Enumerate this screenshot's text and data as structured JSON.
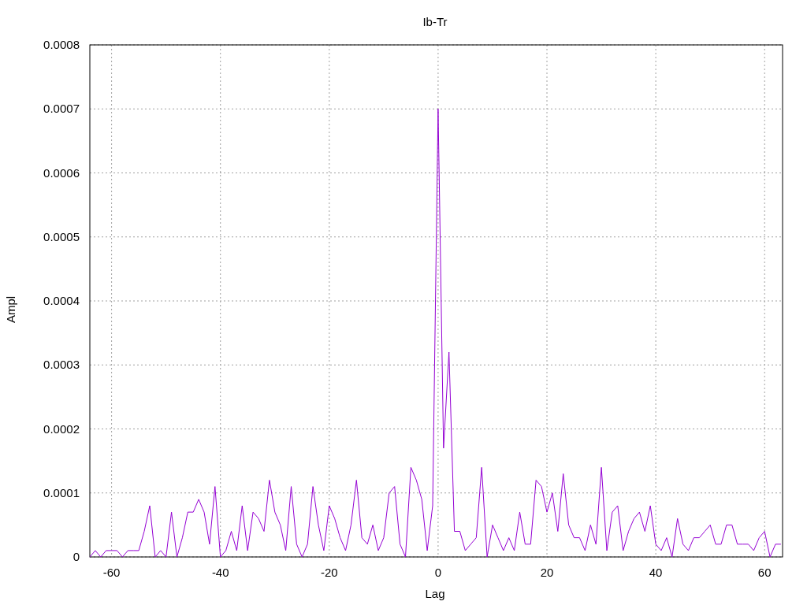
{
  "chart_data": {
    "type": "line",
    "title": "Ib-Tr",
    "xlabel": "Lag",
    "ylabel": "Ampl",
    "x": [
      -64,
      -63,
      -62,
      -61,
      -60,
      -59,
      -58,
      -57,
      -56,
      -55,
      -54,
      -53,
      -52,
      -51,
      -50,
      -49,
      -48,
      -47,
      -46,
      -45,
      -44,
      -43,
      -42,
      -41,
      -40,
      -39,
      -38,
      -37,
      -36,
      -35,
      -34,
      -33,
      -32,
      -31,
      -30,
      -29,
      -28,
      -27,
      -26,
      -25,
      -24,
      -23,
      -22,
      -21,
      -20,
      -19,
      -18,
      -17,
      -16,
      -15,
      -14,
      -13,
      -12,
      -11,
      -10,
      -9,
      -8,
      -7,
      -6,
      -5,
      -4,
      -3,
      -2,
      -1,
      0,
      1,
      2,
      3,
      4,
      5,
      6,
      7,
      8,
      9,
      10,
      11,
      12,
      13,
      14,
      15,
      16,
      17,
      18,
      19,
      20,
      21,
      22,
      23,
      24,
      25,
      26,
      27,
      28,
      29,
      30,
      31,
      32,
      33,
      34,
      35,
      36,
      37,
      38,
      39,
      40,
      41,
      42,
      43,
      44,
      45,
      46,
      47,
      48,
      49,
      50,
      51,
      52,
      53,
      54,
      55,
      56,
      57,
      58,
      59,
      60,
      61,
      62,
      63
    ],
    "series": [
      {
        "color": "#9400d3",
        "values": [
          0,
          1e-05,
          0,
          1e-05,
          1e-05,
          1e-05,
          0,
          1e-05,
          1e-05,
          1e-05,
          4e-05,
          8e-05,
          0,
          1e-05,
          0,
          7e-05,
          0,
          3e-05,
          7e-05,
          7e-05,
          9e-05,
          7e-05,
          2e-05,
          0.00011,
          0,
          1e-05,
          4e-05,
          1e-05,
          8e-05,
          1e-05,
          7e-05,
          6e-05,
          4e-05,
          0.00012,
          7e-05,
          5e-05,
          1e-05,
          0.00011,
          2e-05,
          0,
          2e-05,
          0.00011,
          5e-05,
          1e-05,
          8e-05,
          6e-05,
          3e-05,
          1e-05,
          5e-05,
          0.00012,
          3e-05,
          2e-05,
          5e-05,
          1e-05,
          3e-05,
          0.0001,
          0.00011,
          2e-05,
          0,
          0.00014,
          0.00012,
          9e-05,
          1e-05,
          8e-05,
          0.0007,
          0.00017,
          0.00032,
          4e-05,
          4e-05,
          1e-05,
          2e-05,
          3e-05,
          0.00014,
          0,
          5e-05,
          3e-05,
          1e-05,
          3e-05,
          1e-05,
          7e-05,
          2e-05,
          2e-05,
          0.00012,
          0.00011,
          7e-05,
          0.0001,
          4e-05,
          0.00013,
          5e-05,
          3e-05,
          3e-05,
          1e-05,
          5e-05,
          2e-05,
          0.00014,
          1e-05,
          7e-05,
          8e-05,
          1e-05,
          4e-05,
          6e-05,
          7e-05,
          4e-05,
          8e-05,
          2e-05,
          1e-05,
          3e-05,
          0,
          6e-05,
          2e-05,
          1e-05,
          3e-05,
          3e-05,
          4e-05,
          5e-05,
          2e-05,
          2e-05,
          5e-05,
          5e-05,
          2e-05,
          2e-05,
          2e-05,
          1e-05,
          3e-05,
          4e-05,
          0,
          2e-05,
          2e-05
        ]
      }
    ],
    "grid": true,
    "xlim": [
      -64,
      63.3
    ],
    "ylim": [
      0,
      0.0008
    ],
    "xticks": [
      -60,
      -40,
      -20,
      0,
      20,
      40,
      60
    ],
    "yticks": [
      {
        "value": 0,
        "label": "0"
      },
      {
        "value": 0.0001,
        "label": "0.0001"
      },
      {
        "value": 0.0002,
        "label": "0.0002"
      },
      {
        "value": 0.0003,
        "label": "0.0003"
      },
      {
        "value": 0.0004,
        "label": "0.0004"
      },
      {
        "value": 0.0005,
        "label": "0.0005"
      },
      {
        "value": 0.0006,
        "label": "0.0006"
      },
      {
        "value": 0.0007,
        "label": "0.0007"
      },
      {
        "value": 0.0008,
        "label": "0.0008"
      }
    ]
  }
}
